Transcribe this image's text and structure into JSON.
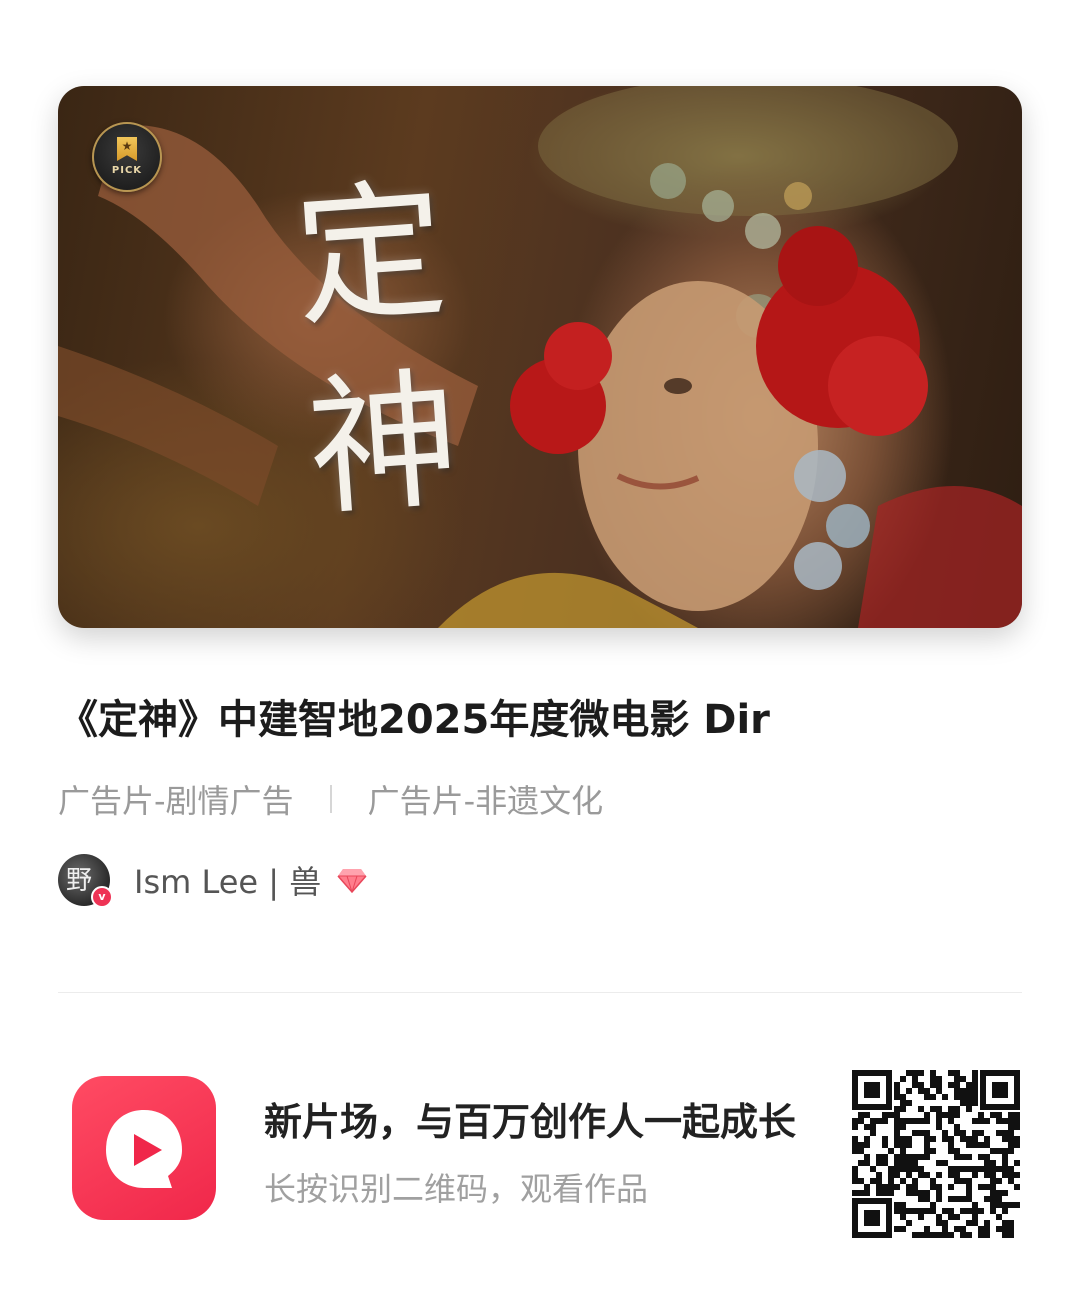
{
  "cover": {
    "calligraphy_line1": "定",
    "calligraphy_line2": "神",
    "badge_label": "PICK",
    "badge_icon": "bookmark-star-icon"
  },
  "video": {
    "title": "《定神》中建智地2025年度微电影 Dir",
    "tags": [
      "广告片-剧情广告",
      "广告片-非遗文化"
    ]
  },
  "author": {
    "name": "Ism Lee | 兽",
    "avatar_text": "野",
    "verified_mark": "v",
    "badge_icon": "diamond-icon"
  },
  "promo": {
    "title": "新片场，与百万创作人一起成长",
    "subtitle": "长按识别二维码，观看作品",
    "logo_icon": "xinpianchang-play-bubble-icon",
    "qr_icon": "qr-code-icon"
  },
  "colors": {
    "brand_red": "#F0274A",
    "title_text": "#1C1C1C",
    "muted_text": "#9A9A9A"
  }
}
